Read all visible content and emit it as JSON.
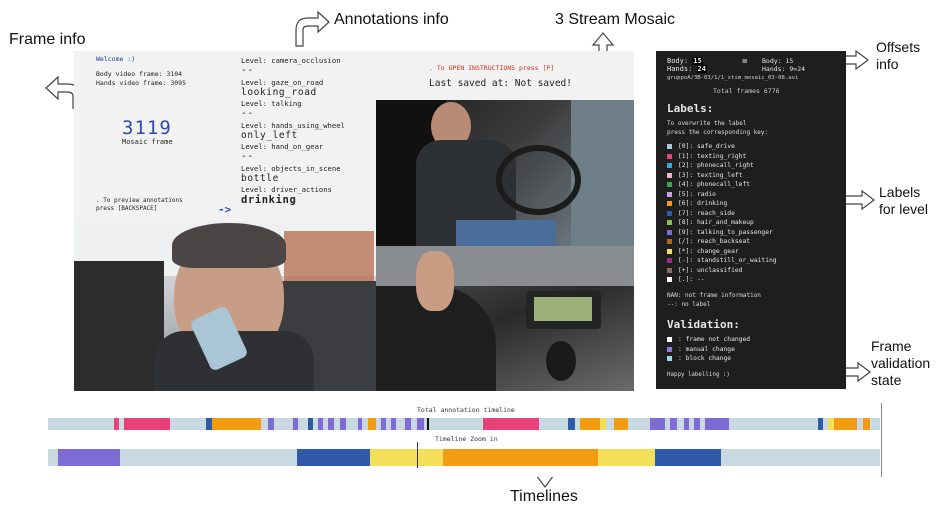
{
  "callouts": {
    "frame_info": "Frame info",
    "annotations_info": "Annotations info",
    "stream_mosaic": "3 Stream Mosaic",
    "offsets_info": "Offsets\ninfo",
    "labels_for_level": "Labels\nfor level",
    "frame_validation_state": "Frame\nvalidation\nstate",
    "timelines": "Timelines"
  },
  "frame_panel": {
    "welcome": "Welcome :)",
    "body_video_frame": "Body video frame: 3104",
    "hands_video_frame": "Hands video frame: 3095",
    "mosaic_frame_number": "3119",
    "mosaic_frame_label": "Mosaic frame",
    "preview_line1": ". To preview annotations",
    "preview_line2": "press [BACKSPACE]"
  },
  "levels": [
    {
      "name": "Level: camera_occlusion",
      "value": "--"
    },
    {
      "name": "Level: gaze_on_road",
      "value": "looking_road"
    },
    {
      "name": "Level: talking",
      "value": "--"
    },
    {
      "name": "Level: hands_using_wheel",
      "value": "only_left"
    },
    {
      "name": "Level: hand_on_gear",
      "value": "--"
    },
    {
      "name": "Level: objects_in_scene",
      "value": "bottle"
    },
    {
      "name": "Level: driver_actions",
      "value": "drinking"
    }
  ],
  "active_arrow": "->",
  "status": {
    "open_instructions": ". To OPEN INSTRUCTIONS press [P]",
    "last_saved": "Last saved at: Not saved!"
  },
  "info_panel": {
    "body_left_label": "Body:",
    "body_left_value": "15",
    "hands_left_label": "Hands:",
    "hands_left_value": "24",
    "equals": "=",
    "body_right": "Body: 15",
    "hands_right": "Hands: 9=24",
    "file_name": "gruppoA/3B-03/1/1_stim_mosaic_03-08.avi",
    "total_frames": "Total frames 6776",
    "labels_title": "Labels:",
    "labels_sub1": "To overwrite the label",
    "labels_sub2": "press the corresponding key:",
    "labels": [
      {
        "text": "[0]: safe_drive",
        "color": "#a9c7d8"
      },
      {
        "text": "[1]: texting_right",
        "color": "#e8417a"
      },
      {
        "text": "[2]: phonecall_right",
        "color": "#2fa9d6"
      },
      {
        "text": "[3]: texting_left",
        "color": "#f0b6c8"
      },
      {
        "text": "[4]: phonecall_left",
        "color": "#3aa84f"
      },
      {
        "text": "[5]: radio",
        "color": "#c9a3e0"
      },
      {
        "text": "[6]: drinking",
        "color": "#f39c12"
      },
      {
        "text": "[7]: reach_side",
        "color": "#2e5aa8"
      },
      {
        "text": "[8]: hair_and_makeup",
        "color": "#8bc34a"
      },
      {
        "text": "[9]: talking_to_passenger",
        "color": "#7e6bd6"
      },
      {
        "text": "[/]: reach_backseat",
        "color": "#b5651d"
      },
      {
        "text": "[*]: change_gear",
        "color": "#f4df5a"
      },
      {
        "text": "[-]: standstill_or_waiting",
        "color": "#9b2d8a"
      },
      {
        "text": "[+]: unclassified",
        "color": "#8d6e63"
      },
      {
        "text": "[.]: --",
        "color": "#ffffff"
      }
    ],
    "nan_line1": "NAN: not frame information",
    "nan_line2": "--: no label",
    "validation_title": "Validation:",
    "validation": [
      {
        "text": ": frame not changed",
        "color": "#ffffff"
      },
      {
        "text": ": manual change",
        "color": "#8c7ae6"
      },
      {
        "text": ": block change",
        "color": "#9fd6e6"
      }
    ],
    "happy": "Happy labelling :)"
  },
  "timelines": {
    "total_title": "Total annotation timeline",
    "zoom_title": "Timeline Zoom in",
    "total_segments": [
      {
        "start": 0.079,
        "end": 0.085,
        "color": "#e8417a"
      },
      {
        "start": 0.091,
        "end": 0.147,
        "color": "#e8417a"
      },
      {
        "start": 0.19,
        "end": 0.197,
        "color": "#2e5aa8"
      },
      {
        "start": 0.197,
        "end": 0.256,
        "color": "#f39c12"
      },
      {
        "start": 0.264,
        "end": 0.272,
        "color": "#7e6bd6"
      },
      {
        "start": 0.294,
        "end": 0.3,
        "color": "#7e6bd6"
      },
      {
        "start": 0.312,
        "end": 0.318,
        "color": "#2e5aa8"
      },
      {
        "start": 0.324,
        "end": 0.33,
        "color": "#7e6bd6"
      },
      {
        "start": 0.337,
        "end": 0.344,
        "color": "#7e6bd6"
      },
      {
        "start": 0.351,
        "end": 0.358,
        "color": "#7e6bd6"
      },
      {
        "start": 0.372,
        "end": 0.378,
        "color": "#7e6bd6"
      },
      {
        "start": 0.385,
        "end": 0.394,
        "color": "#f39c12"
      },
      {
        "start": 0.4,
        "end": 0.406,
        "color": "#7e6bd6"
      },
      {
        "start": 0.412,
        "end": 0.418,
        "color": "#7e6bd6"
      },
      {
        "start": 0.429,
        "end": 0.436,
        "color": "#7e6bd6"
      },
      {
        "start": 0.444,
        "end": 0.452,
        "color": "#7e6bd6"
      },
      {
        "start": 0.523,
        "end": 0.59,
        "color": "#e8417a"
      },
      {
        "start": 0.625,
        "end": 0.633,
        "color": "#2e5aa8"
      },
      {
        "start": 0.639,
        "end": 0.663,
        "color": "#f39c12"
      },
      {
        "start": 0.663,
        "end": 0.671,
        "color": "#f4df5a"
      },
      {
        "start": 0.68,
        "end": 0.697,
        "color": "#f39c12"
      },
      {
        "start": 0.724,
        "end": 0.742,
        "color": "#7e6bd6"
      },
      {
        "start": 0.748,
        "end": 0.756,
        "color": "#7e6bd6"
      },
      {
        "start": 0.764,
        "end": 0.771,
        "color": "#7e6bd6"
      },
      {
        "start": 0.777,
        "end": 0.784,
        "color": "#7e6bd6"
      },
      {
        "start": 0.79,
        "end": 0.818,
        "color": "#7e6bd6"
      },
      {
        "start": 0.925,
        "end": 0.932,
        "color": "#2e5aa8"
      },
      {
        "start": 0.938,
        "end": 0.945,
        "color": "#f4df5a"
      },
      {
        "start": 0.945,
        "end": 0.972,
        "color": "#f39c12"
      },
      {
        "start": 0.98,
        "end": 0.988,
        "color": "#f39c12"
      }
    ],
    "zoom_segments": [
      {
        "start": 0.012,
        "end": 0.087,
        "color": "#7e6bd6"
      },
      {
        "start": 0.299,
        "end": 0.387,
        "color": "#2e5aa8"
      },
      {
        "start": 0.387,
        "end": 0.475,
        "color": "#f4df5a"
      },
      {
        "start": 0.475,
        "end": 0.661,
        "color": "#f39c12"
      },
      {
        "start": 0.661,
        "end": 0.73,
        "color": "#f4df5a"
      },
      {
        "start": 0.73,
        "end": 0.809,
        "color": "#2e5aa8"
      }
    ],
    "total_marker": 0.456
  }
}
